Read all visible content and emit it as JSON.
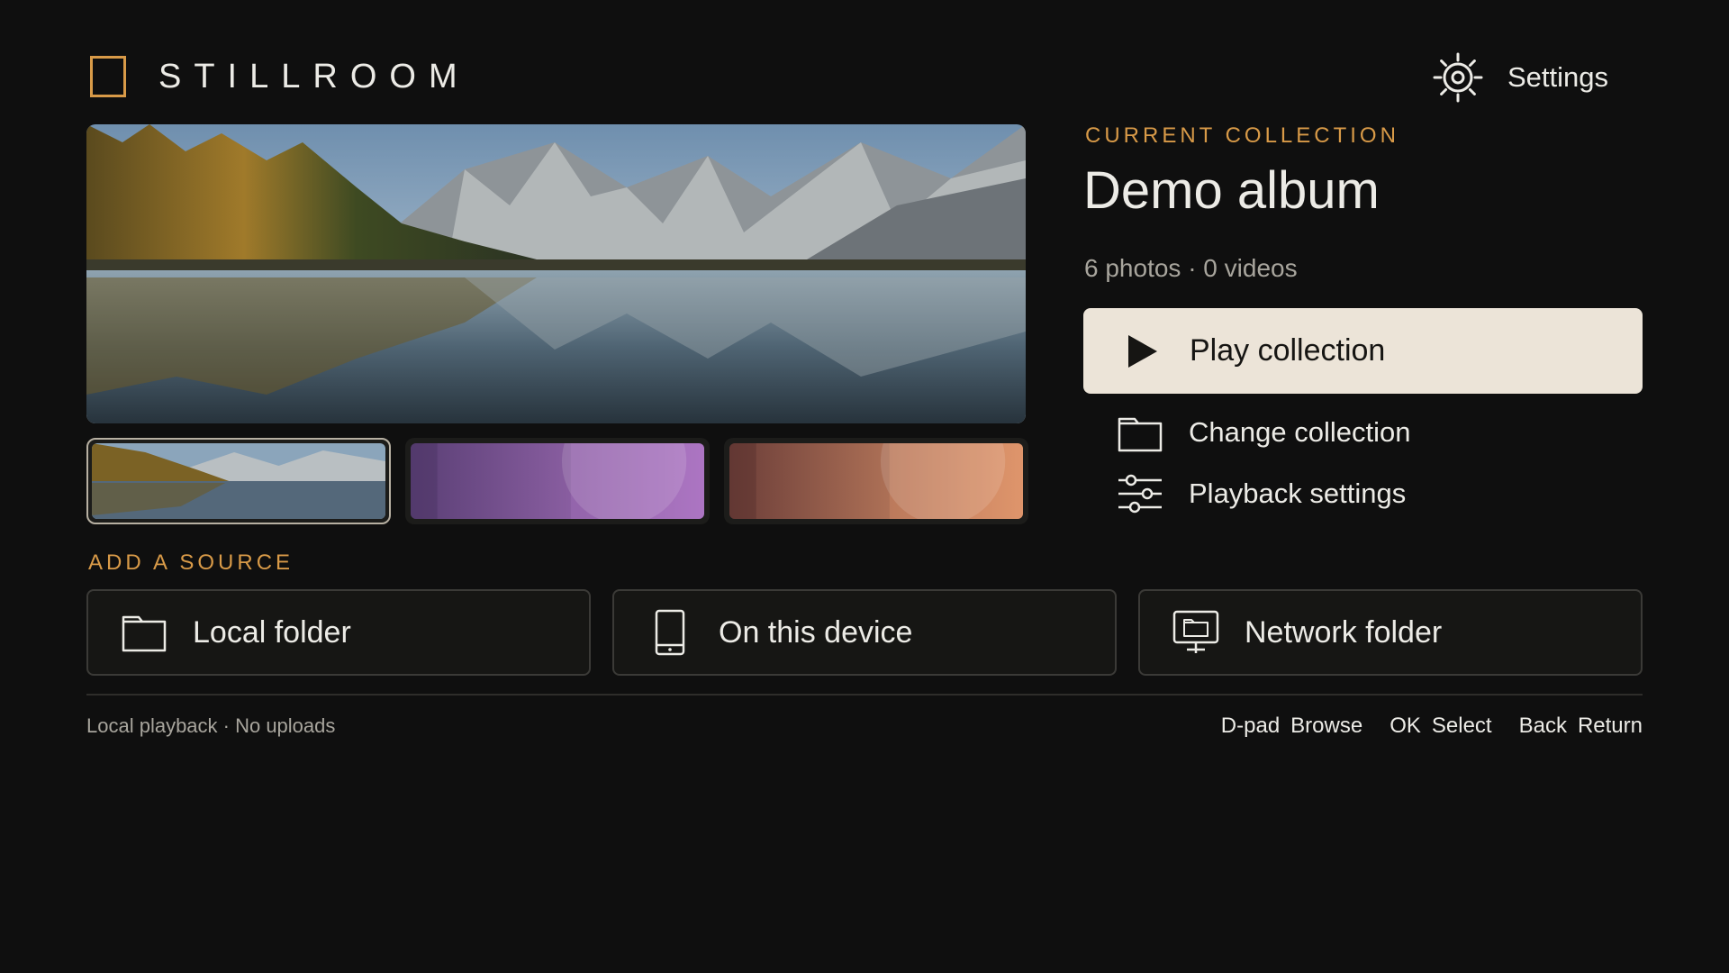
{
  "app": {
    "name": "STILLROOM"
  },
  "header": {
    "settings_label": "Settings"
  },
  "collection": {
    "eyebrow": "CURRENT COLLECTION",
    "title": "Demo album",
    "meta": "6 photos · 0 videos"
  },
  "actions": {
    "play": "Play collection",
    "change": "Change collection",
    "playback_settings": "Playback settings"
  },
  "sources": {
    "eyebrow": "ADD A SOURCE",
    "items": [
      {
        "label": "Local folder",
        "icon": "folder-icon"
      },
      {
        "label": "On this device",
        "icon": "phone-icon"
      },
      {
        "label": "Network folder",
        "icon": "network-folder-icon"
      }
    ]
  },
  "footer": {
    "status": "Local playback · No uploads",
    "hints": [
      {
        "key": "D-pad",
        "action": "Browse"
      },
      {
        "key": "OK",
        "action": "Select"
      },
      {
        "key": "Back",
        "action": "Return"
      }
    ]
  },
  "colors": {
    "background": "#0f0f0f",
    "accent": "#d89a48",
    "primary_button": "#ece4d8",
    "text": "#ecebe6",
    "muted_text": "#a8a59d"
  }
}
